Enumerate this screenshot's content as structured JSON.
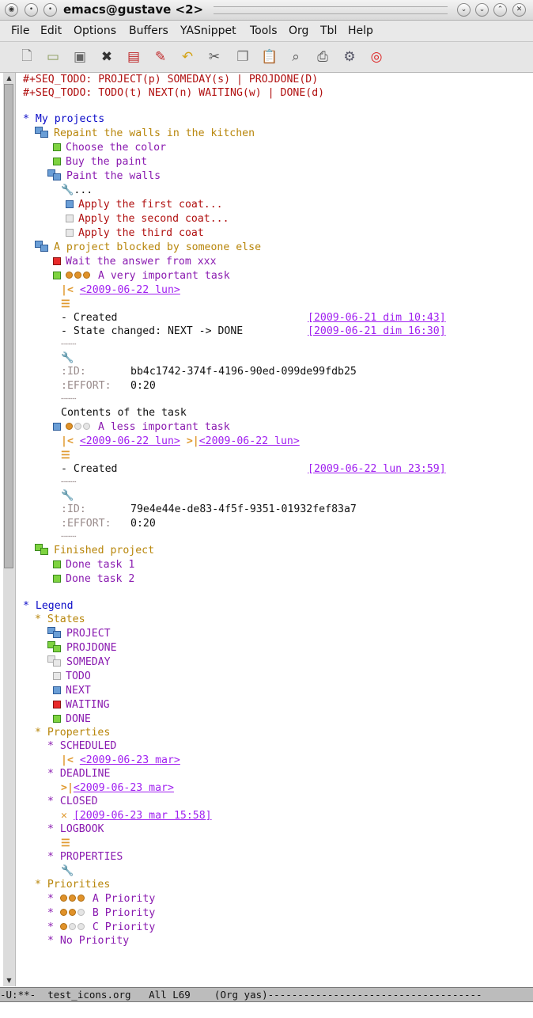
{
  "window": {
    "title": "emacs@gustave <2>"
  },
  "menu": [
    "File",
    "Edit",
    "Options",
    "Buffers",
    "YASnippet",
    "Tools",
    "Org",
    "Tbl",
    "Help"
  ],
  "toolbar_icons": [
    "new-file-icon",
    "open-folder-icon",
    "save-disk-icon",
    "close-x-icon",
    "save-as-icon",
    "edit-icon",
    "undo-icon",
    "cut-scissors-icon",
    "copy-icon",
    "paste-icon",
    "search-icon",
    "print-icon",
    "preferences-icon",
    "help-lifebuoy-icon"
  ],
  "buffer": {
    "seq1": "#+SEQ_TODO: PROJECT(p) SOMEDAY(s) | PROJDONE(D)",
    "seq2": "#+SEQ_TODO: TODO(t) NEXT(n) WAITING(w) | DONE(d)",
    "my_projects": "* My projects",
    "repaint": "Repaint the walls in the kitchen",
    "choose": "Choose the color",
    "buy": "Buy the paint",
    "paint": "Paint the walls",
    "ellipsis": "...",
    "first_coat": "Apply the first coat...",
    "second_coat": "Apply the second coat...",
    "third_coat": "Apply the third coat",
    "blocked": "A project blocked by someone else",
    "wait": "Wait the answer from xxx",
    "very_important": "A very important task",
    "sched1": "<2009-06-22 lun>",
    "created_label": "- Created",
    "created_ts": "[2009-06-21 dim 10:43]",
    "state_label": "- State changed: NEXT -> DONE",
    "state_ts": "[2009-06-21 dim 16:30]",
    "id_key": ":ID:",
    "id1": "bb4c1742-374f-4196-90ed-099de99fdb25",
    "effort_key": ":EFFORT:",
    "effort1": "0:20",
    "contents": "Contents of the task",
    "less_important": "A less important task",
    "sched2": "<2009-06-22 lun>",
    "deadline2": "<2009-06-22 lun>",
    "created2_ts": "[2009-06-22 lun 23:59]",
    "id2": "79e4e44e-de83-4f5f-9351-01932fef83a7",
    "effort2": "0:20",
    "finished": "Finished project",
    "done1": "Done task 1",
    "done2": "Done task 2",
    "legend": "* Legend",
    "states": "* States",
    "st_project": "PROJECT",
    "st_projdone": "PROJDONE",
    "st_someday": "SOMEDAY",
    "st_todo": "TODO",
    "st_next": "NEXT",
    "st_waiting": "WAITING",
    "st_done": "DONE",
    "properties": "* Properties",
    "p_scheduled": "* SCHEDULED",
    "p_sched_ts": "<2009-06-23 mar>",
    "p_deadline": "* DEADLINE",
    "p_dead_ts": "<2009-06-23 mar>",
    "p_closed": "* CLOSED",
    "p_closed_ts": "[2009-06-23 mar 15:58]",
    "p_logbook": "* LOGBOOK",
    "p_properties": "* PROPERTIES",
    "priorities": "* Priorities",
    "pr_a": "A Priority",
    "pr_b": "B Priority",
    "pr_c": "C Priority",
    "pr_star": "*",
    "pr_none": "* No Priority"
  },
  "modeline": "-U:**-  test_icons.org   All L69    (Org yas)------------------------------------",
  "colors": {
    "done": "#7ed340",
    "next": "#6a9ed6",
    "waiting": "#e82a2a",
    "todo": "#e8e8e8",
    "priority": "#e0922a"
  }
}
